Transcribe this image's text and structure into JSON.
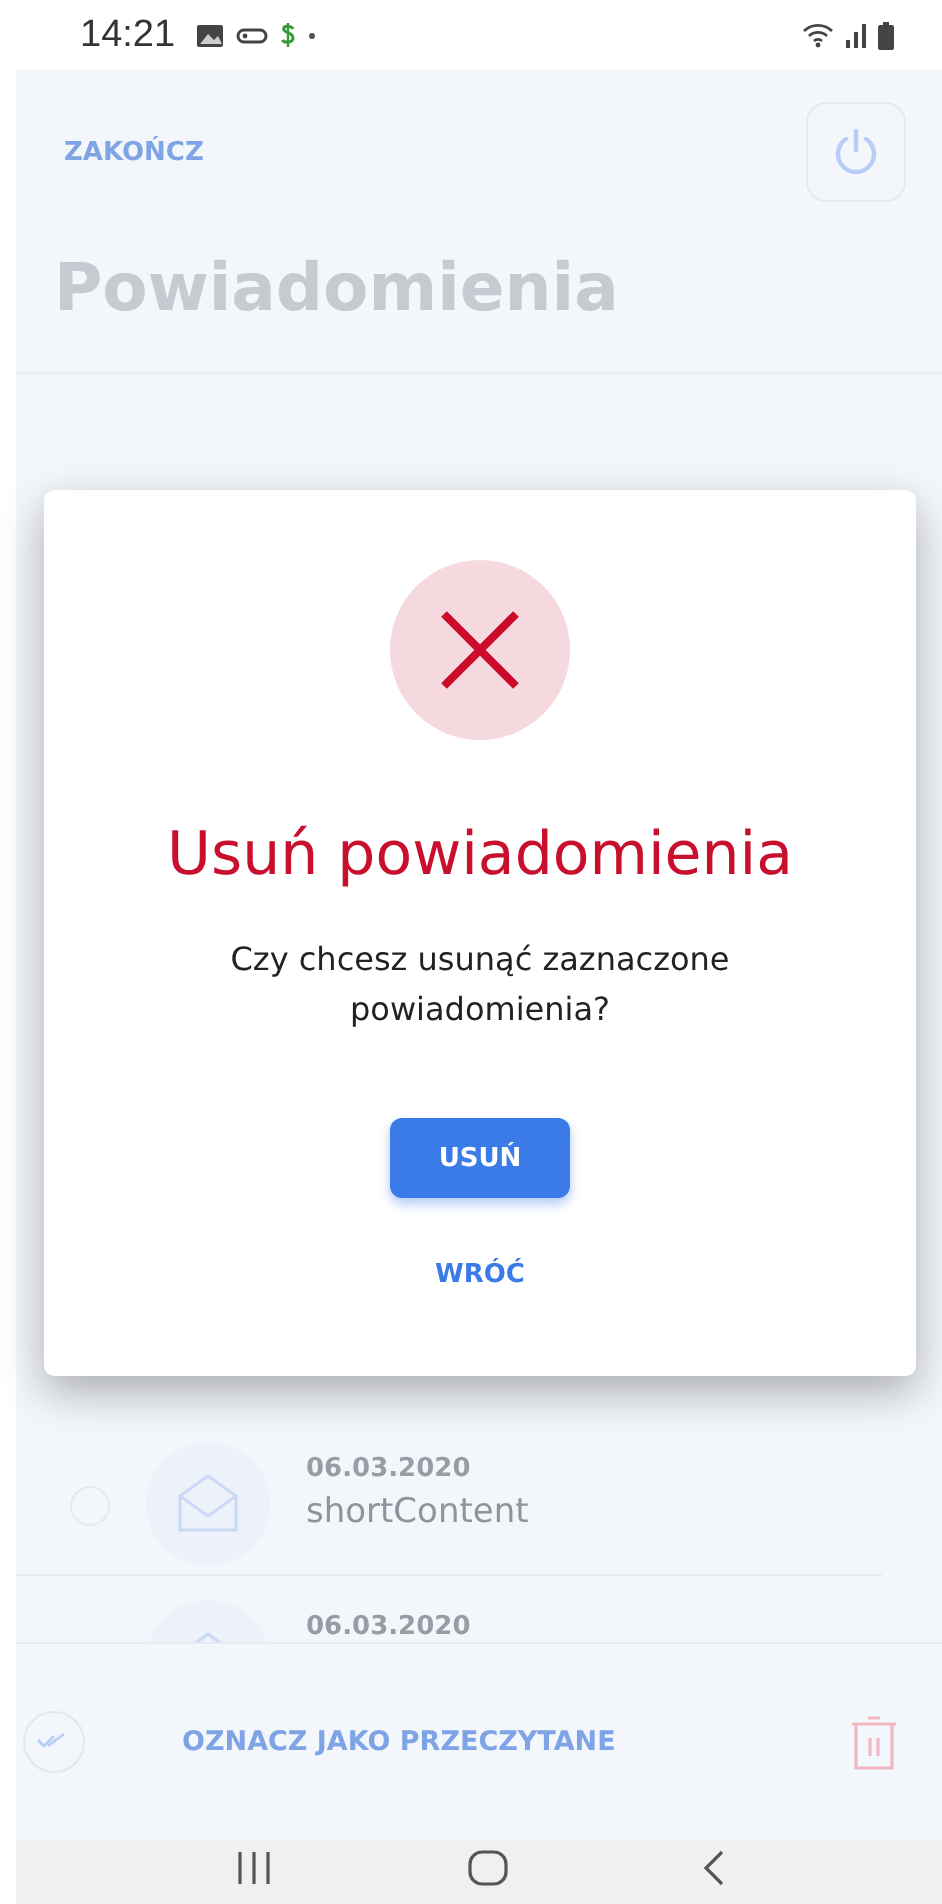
{
  "status_bar": {
    "time": "14:21"
  },
  "header": {
    "end_label": "ZAKOŃCZ",
    "title": "Powiadomienia"
  },
  "notifications": [
    {
      "date": "06.03.2020",
      "content": "shortContent",
      "checked": false
    },
    {
      "date": "06.03.2020"
    }
  ],
  "bottom_bar": {
    "mark_read_label": "OZNACZ JAKO PRZECZYTANE"
  },
  "dialog": {
    "title": "Usuń powiadomienia",
    "message": "Czy chcesz usunąć zaznaczone powiadomienia?",
    "confirm_label": "USUŃ",
    "back_label": "WRÓĆ"
  }
}
